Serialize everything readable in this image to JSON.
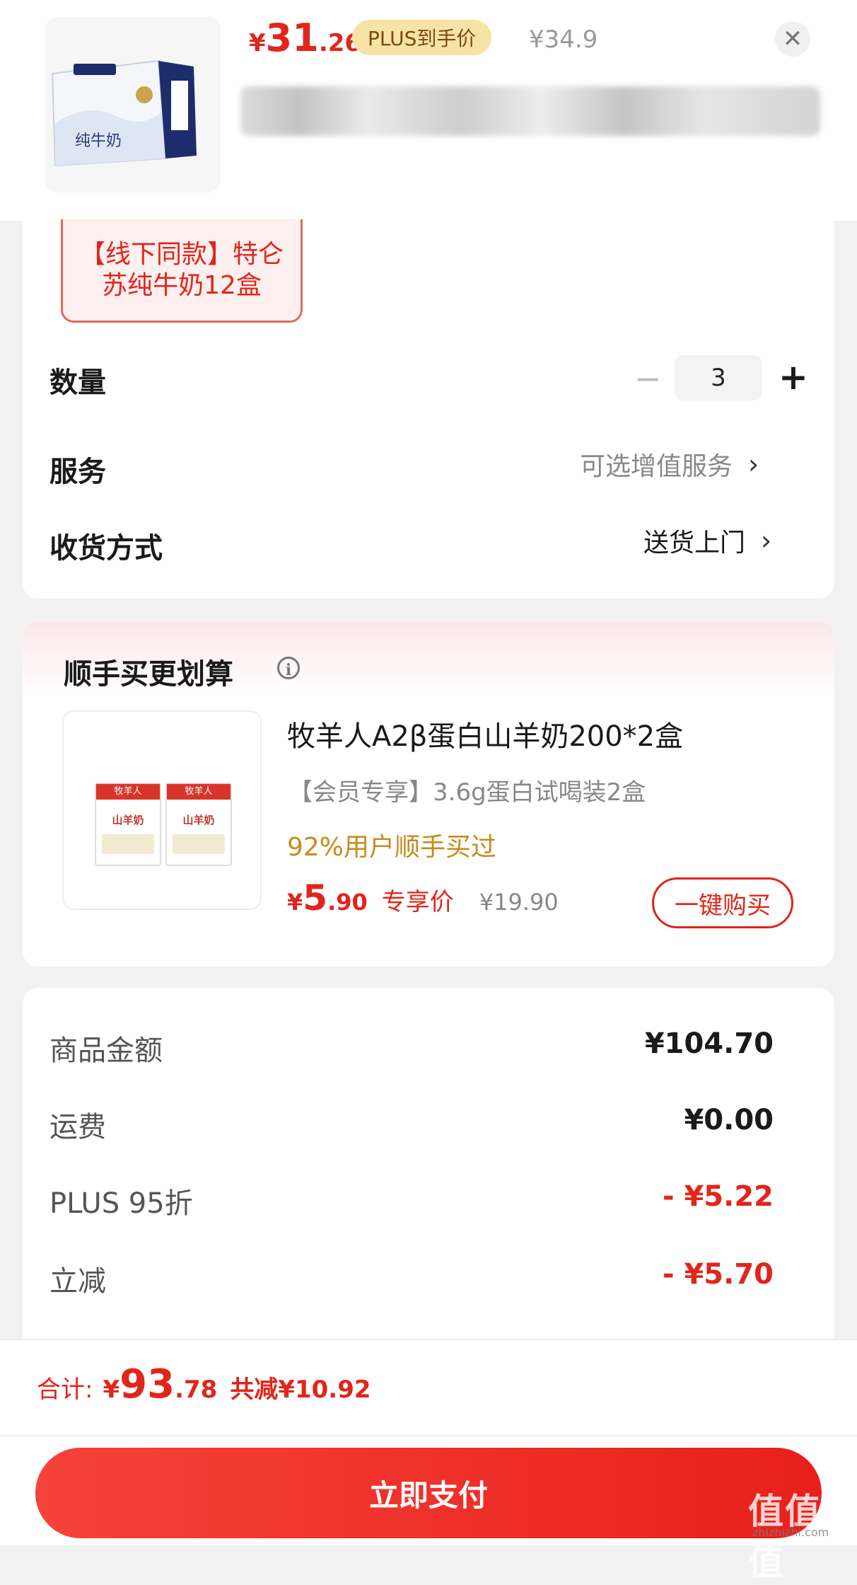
{
  "header": {
    "price_currency": "¥",
    "price_int": "31",
    "price_dec": ".26",
    "plus_tag": "PLUS到手价",
    "original_price": "¥34.9",
    "close_icon": "close-icon",
    "product_image_label": "纯牛奶"
  },
  "variant": {
    "selected_label": "【线下同款】特仑苏纯牛奶12盒"
  },
  "rows": {
    "quantity_label": "数量",
    "quantity_value": "3",
    "minus": "−",
    "plus": "+",
    "service_label": "服务",
    "service_value": "可选增值服务",
    "delivery_label": "收货方式",
    "delivery_value": "送货上门",
    "chevron": "›"
  },
  "addon": {
    "section_title": "顺手买更划算",
    "info_icon": "i",
    "product_title": "牧羊人A2β蛋白山羊奶200*2盒",
    "product_subtitle": "【会员专享】3.6g蛋白试喝装2盒",
    "social_proof": "92%用户顺手买过",
    "price_currency": "¥",
    "price_int": "5",
    "price_dec": ".90",
    "price_tag": "专享价",
    "original_price": "¥19.90",
    "buy_button": "一键购买",
    "box_brand": "牧羊人",
    "box_name": "山羊奶"
  },
  "summary": {
    "items": [
      {
        "label": "商品金额",
        "value": "¥104.70"
      },
      {
        "label": "运费",
        "value": "¥0.00"
      },
      {
        "label": "PLUS 95折",
        "value": "- ¥5.22"
      },
      {
        "label": "立减",
        "value": "- ¥5.70"
      }
    ]
  },
  "footer": {
    "total_label": "合计:",
    "total_currency": "¥",
    "total_int": "93",
    "total_dec": ".78",
    "total_discount": "共减¥10.92",
    "pay_button": "立即支付",
    "watermark": "值值值",
    "watermark_sub": "zhizhizhi.com"
  },
  "colors": {
    "accent_red": "#e1251b",
    "plus_gold": "#f8e3a6",
    "social_proof_gold": "#c98a1b"
  }
}
